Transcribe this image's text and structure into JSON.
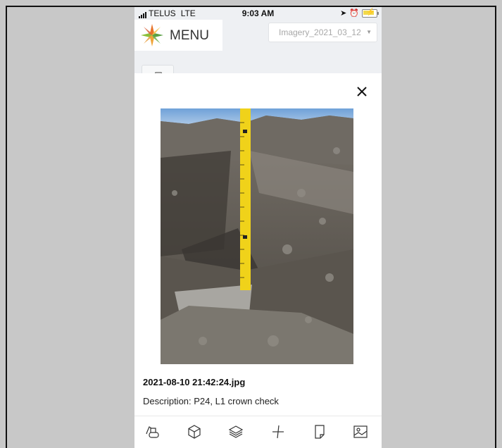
{
  "status_bar": {
    "carrier": "TELUS",
    "network": "LTE",
    "time": "9:03 AM"
  },
  "header": {
    "menu_label": "MENU",
    "imagery_select": "Imagery_2021_03_12"
  },
  "icons": {
    "logo": "compass-star-logo",
    "camera": "camera-icon",
    "close": "close-icon",
    "toolbar": [
      "excavator-icon",
      "cube-icon",
      "layers-icon",
      "measure-icon",
      "note-icon",
      "image-icon"
    ]
  },
  "photo": {
    "file_name": "2021-08-10 21:42:24.jpg",
    "description": "Description: P24, L1 crown check"
  },
  "colors": {
    "accent_orange": "#e8742a",
    "accent_green": "#5aa045",
    "tape_yellow": "#f0d21a"
  }
}
